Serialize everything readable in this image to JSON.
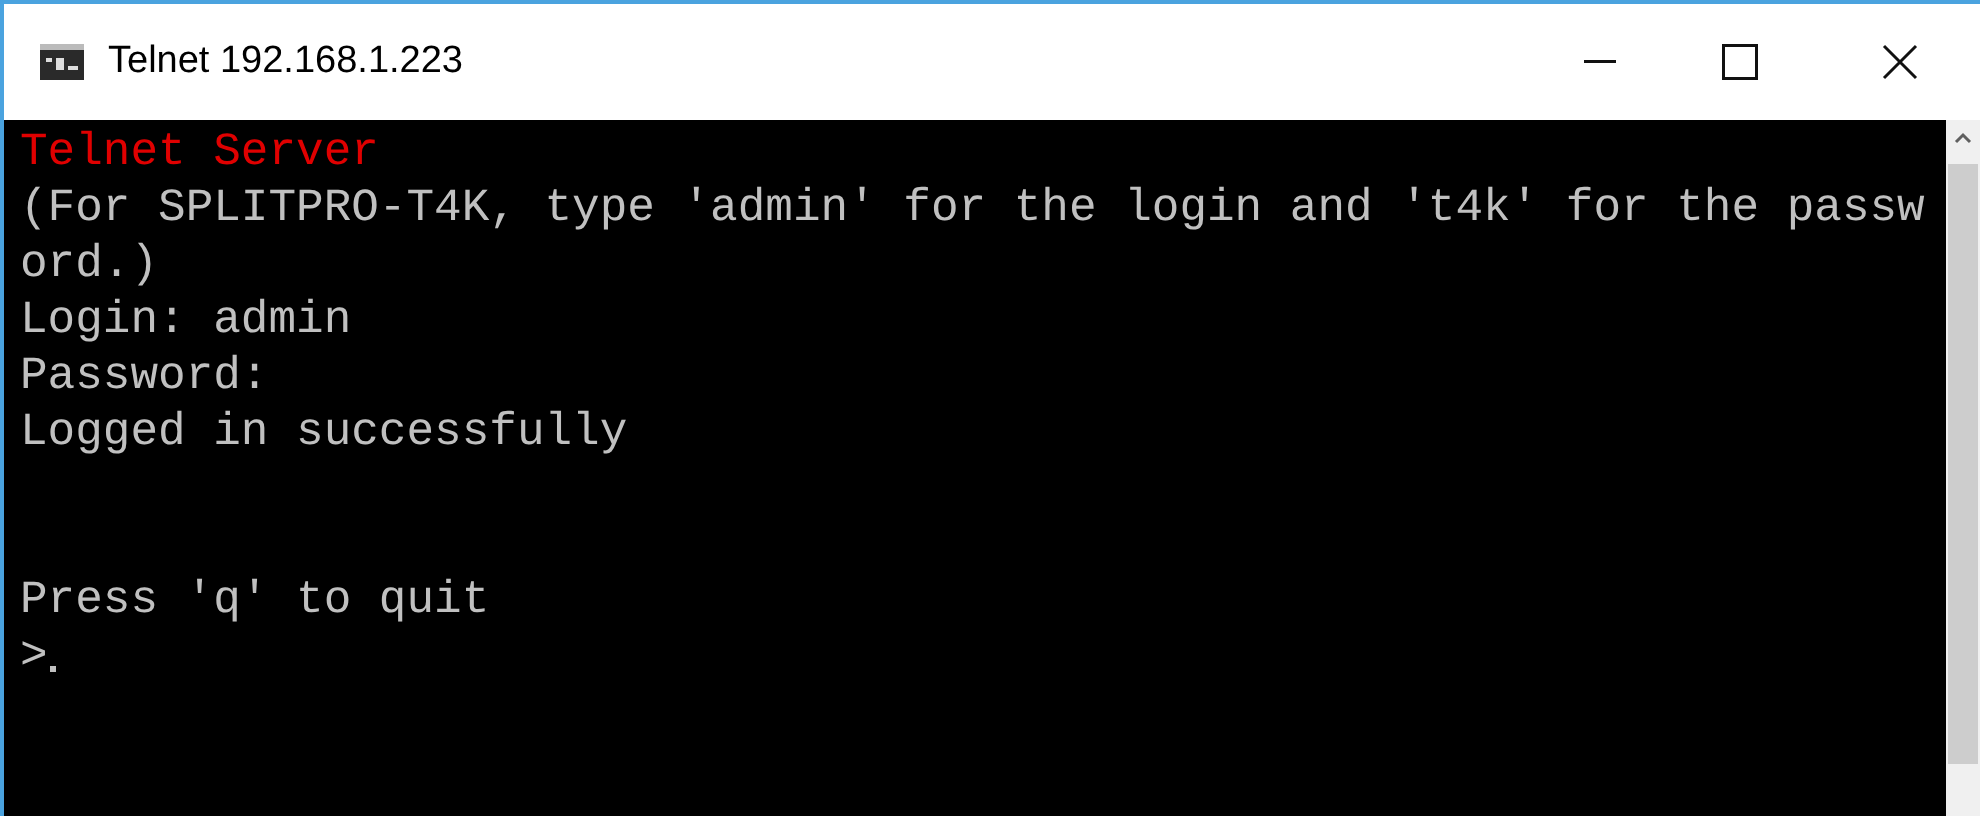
{
  "window": {
    "title": "Telnet 192.168.1.223"
  },
  "console": {
    "lines": [
      {
        "text": "Telnet Server",
        "kind": "banner"
      },
      {
        "text": "(For SPLITPRO-T4K, type 'admin' for the login and 't4k' for the passw",
        "kind": "text"
      },
      {
        "text": "ord.)",
        "kind": "text"
      },
      {
        "text": "Login: admin",
        "kind": "text"
      },
      {
        "text": "Password:",
        "kind": "text"
      },
      {
        "text": "Logged in successfully",
        "kind": "text"
      },
      {
        "text": "Press 'q' to quit",
        "kind": "spaced"
      },
      {
        "text": ">",
        "kind": "prompt"
      }
    ]
  }
}
